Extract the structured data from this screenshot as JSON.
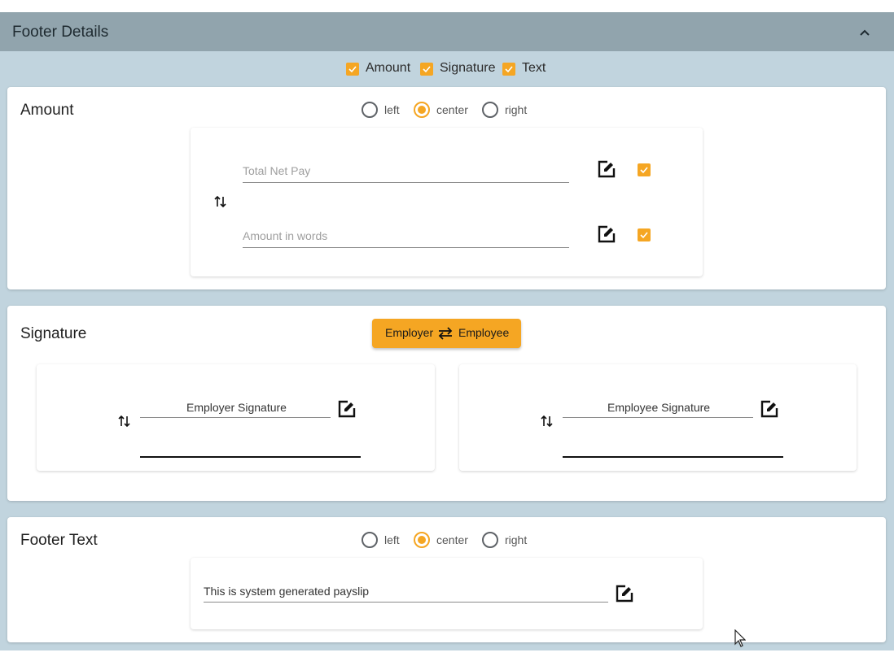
{
  "header": {
    "title": "Footer Details"
  },
  "toggles": [
    {
      "label": "Amount",
      "checked": true
    },
    {
      "label": "Signature",
      "checked": true
    },
    {
      "label": "Text",
      "checked": true
    }
  ],
  "amount": {
    "title": "Amount",
    "align_options": [
      "left",
      "center",
      "right"
    ],
    "align_selected": "center",
    "fields": [
      {
        "placeholder": "Total Net Pay",
        "checked": true
      },
      {
        "placeholder": "Amount in words",
        "checked": true
      }
    ]
  },
  "signature": {
    "title": "Signature",
    "swap_button": {
      "left": "Employer",
      "right": "Employee"
    },
    "employer": {
      "label": "Employer Signature"
    },
    "employee": {
      "label": "Employee Signature"
    }
  },
  "footer_text": {
    "title": "Footer Text",
    "align_options": [
      "left",
      "center",
      "right"
    ],
    "align_selected": "center",
    "value": "This is system generated payslip"
  },
  "colors": {
    "accent": "#f5a623",
    "header_bg": "#91a4ad",
    "panel_bg": "#c1d4de"
  },
  "icons": [
    "chevron-up-icon",
    "swap-vertical-icon",
    "edit-icon",
    "swap-horizontal-icon",
    "mouse-cursor-icon"
  ]
}
